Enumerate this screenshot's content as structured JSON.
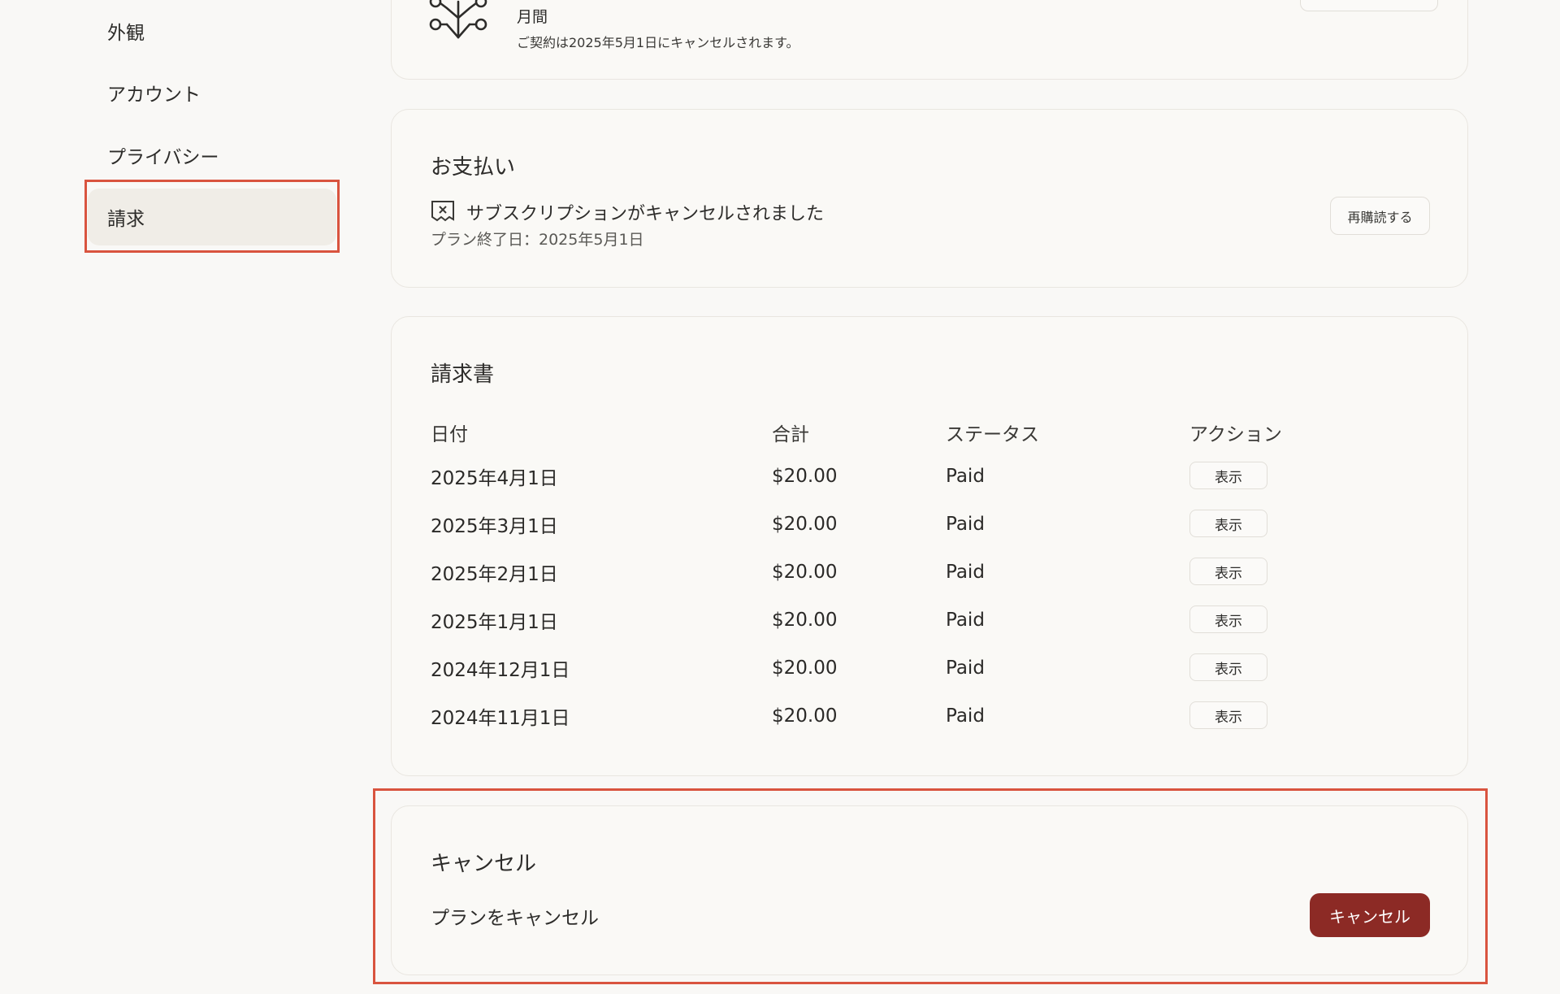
{
  "sidebar": {
    "items": [
      {
        "label": "外観"
      },
      {
        "label": "アカウント"
      },
      {
        "label": "プライバシー"
      },
      {
        "label": "請求"
      }
    ]
  },
  "plan_card": {
    "plan_period": "月間",
    "notice": "ご契約は2025年5月1日にキャンセルされます。"
  },
  "payment": {
    "title": "お支払い",
    "status_text": "サブスクリプションがキャンセルされました",
    "end_date": "プラン終了日：2025年5月1日",
    "resubscribe_label": "再購読する"
  },
  "invoices": {
    "title": "請求書",
    "columns": [
      "日付",
      "合計",
      "ステータス",
      "アクション"
    ],
    "rows": [
      {
        "date": "2025年4月1日",
        "total": "$20.00",
        "status": "Paid",
        "action": "表示"
      },
      {
        "date": "2025年3月1日",
        "total": "$20.00",
        "status": "Paid",
        "action": "表示"
      },
      {
        "date": "2025年2月1日",
        "total": "$20.00",
        "status": "Paid",
        "action": "表示"
      },
      {
        "date": "2025年1月1日",
        "total": "$20.00",
        "status": "Paid",
        "action": "表示"
      },
      {
        "date": "2024年12月1日",
        "total": "$20.00",
        "status": "Paid",
        "action": "表示"
      },
      {
        "date": "2024年11月1日",
        "total": "$20.00",
        "status": "Paid",
        "action": "表示"
      }
    ]
  },
  "cancel": {
    "title": "キャンセル",
    "description": "プランをキャンセル",
    "button_label": "キャンセル"
  },
  "colors": {
    "accent": "#8c2a25",
    "highlight": "#d9543f"
  }
}
